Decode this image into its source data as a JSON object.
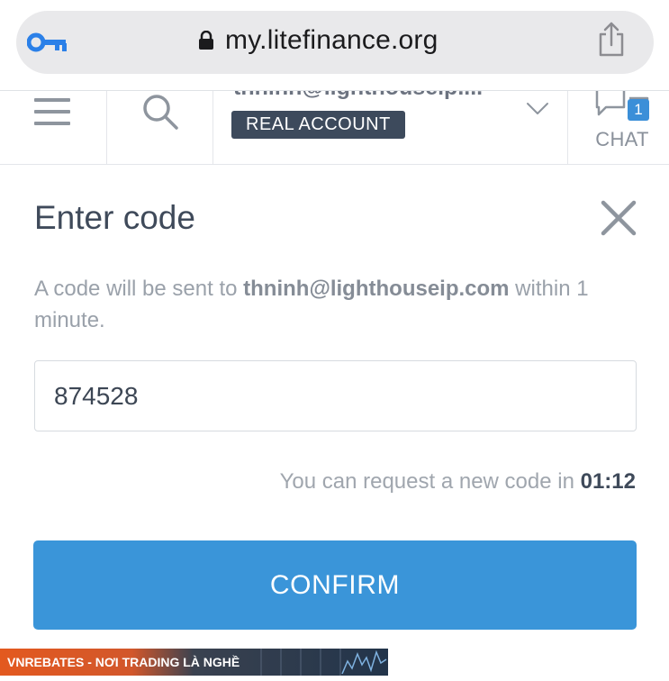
{
  "browser": {
    "url": "my.litefinance.org"
  },
  "header": {
    "account_email": "thninh@lighthouseip....",
    "account_type": "REAL ACCOUNT",
    "chat_label": "CHAT",
    "chat_count": "1"
  },
  "modal": {
    "title": "Enter code",
    "desc_prefix": "A code will be sent to ",
    "desc_email": "thninh@lighthouseip.com",
    "desc_suffix": " within 1 minute.",
    "code_value": "874528",
    "resend_text": "You can request a new code in ",
    "resend_timer": "01:12",
    "confirm_label": "CONFIRM"
  },
  "watermark": {
    "text": "VNREBATES - NƠI TRADING LÀ NGHỀ"
  },
  "colors": {
    "accent": "#3a95d9",
    "badge": "#3d4a5c",
    "title": "#3f4a5a"
  },
  "icons": {
    "key": "key-icon",
    "lock": "lock-icon",
    "share": "share-icon",
    "menu": "menu-icon",
    "search": "search-icon",
    "chevron": "chevron-down-icon",
    "chat": "chat-icon",
    "close": "close-icon"
  }
}
